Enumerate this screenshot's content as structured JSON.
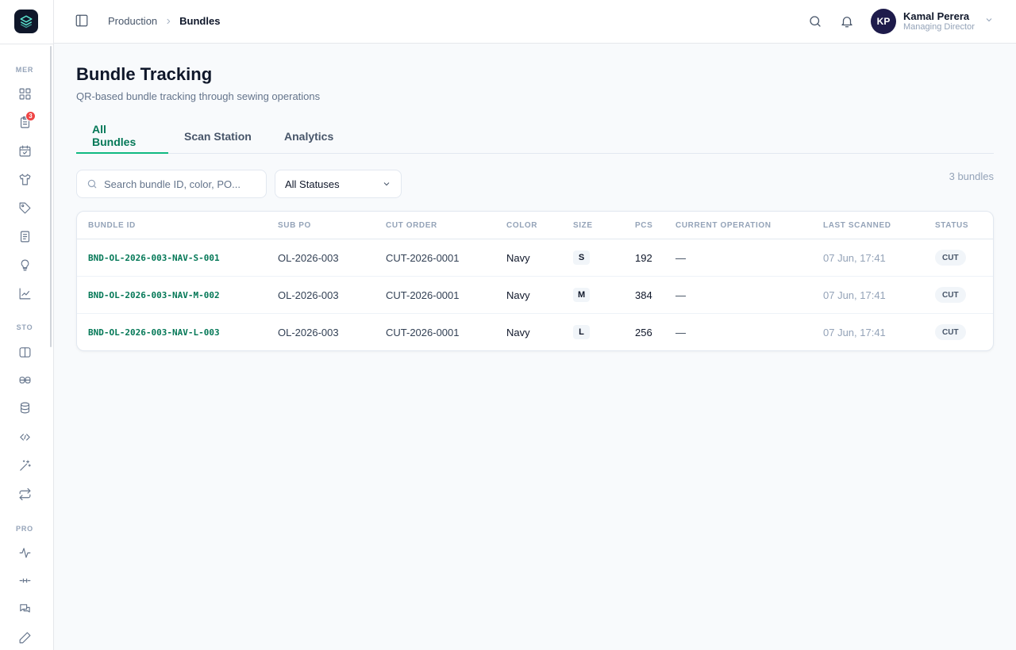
{
  "sidebar": {
    "logo_icon": "layers-icon",
    "sections": [
      {
        "label": "MER",
        "items": [
          {
            "icon": "dashboard-icon",
            "badge": ""
          },
          {
            "icon": "orders-icon",
            "badge": "3"
          },
          {
            "icon": "calendar-icon",
            "badge": ""
          },
          {
            "icon": "shirt-icon",
            "badge": ""
          },
          {
            "icon": "tag-icon",
            "badge": ""
          },
          {
            "icon": "document-icon",
            "badge": ""
          },
          {
            "icon": "lightbulb-icon",
            "badge": ""
          },
          {
            "icon": "chart-icon",
            "badge": ""
          }
        ]
      },
      {
        "label": "STO",
        "items": [
          {
            "icon": "book-icon"
          },
          {
            "icon": "fabric-icon"
          },
          {
            "icon": "database-icon"
          },
          {
            "icon": "transfer-icon"
          },
          {
            "icon": "wand-icon"
          },
          {
            "icon": "repeat-icon"
          }
        ]
      },
      {
        "label": "PRO",
        "items": [
          {
            "icon": "activity-icon"
          },
          {
            "icon": "line-icon"
          },
          {
            "icon": "messages-icon"
          },
          {
            "icon": "pencil-icon"
          }
        ]
      }
    ]
  },
  "header": {
    "breadcrumb": {
      "parent": "Production",
      "current": "Bundles"
    },
    "user": {
      "initials": "KP",
      "name": "Kamal Perera",
      "role": "Managing Director"
    }
  },
  "page": {
    "title": "Bundle Tracking",
    "subtitle": "QR-based bundle tracking through sewing operations",
    "tabs": [
      "All Bundles",
      "Scan Station",
      "Analytics"
    ],
    "active_tab": "All Bundles"
  },
  "filters": {
    "search_placeholder": "Search bundle ID, color, PO...",
    "search_value": "",
    "status_selected": "All Statuses",
    "count_text": "3 bundles"
  },
  "table": {
    "columns": [
      "BUNDLE ID",
      "SUB PO",
      "CUT ORDER",
      "COLOR",
      "SIZE",
      "PCS",
      "CURRENT OPERATION",
      "LAST SCANNED",
      "STATUS"
    ],
    "rows": [
      {
        "bundle_id": "BND-OL-2026-003-NAV-S-001",
        "sub_po": "OL-2026-003",
        "cut_order": "CUT-2026-0001",
        "color": "Navy",
        "size": "S",
        "pcs": "192",
        "operation": "—",
        "last_scanned": "07 Jun, 17:41",
        "status": "CUT"
      },
      {
        "bundle_id": "BND-OL-2026-003-NAV-M-002",
        "sub_po": "OL-2026-003",
        "cut_order": "CUT-2026-0001",
        "color": "Navy",
        "size": "M",
        "pcs": "384",
        "operation": "—",
        "last_scanned": "07 Jun, 17:41",
        "status": "CUT"
      },
      {
        "bundle_id": "BND-OL-2026-003-NAV-L-003",
        "sub_po": "OL-2026-003",
        "cut_order": "CUT-2026-0001",
        "color": "Navy",
        "size": "L",
        "pcs": "256",
        "operation": "—",
        "last_scanned": "07 Jun, 17:41",
        "status": "CUT"
      }
    ]
  },
  "colors": {
    "accent": "#047857",
    "accent_light": "#10b981",
    "badge": "#ef4444",
    "avatar": "#1e1b4b"
  }
}
